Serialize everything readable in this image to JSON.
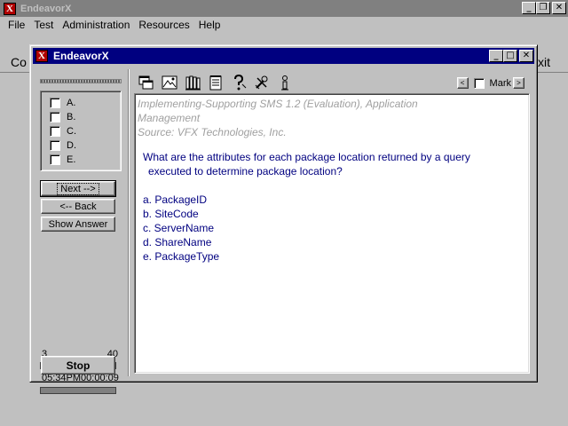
{
  "app": {
    "title": "EndeavorX",
    "icon_glyph": "X",
    "colors": {
      "titlebar_inactive": "#808080",
      "titlebar_active": "#000080",
      "face": "#c0c0c0",
      "question_text": "#000080",
      "source_text": "#a0a0a0",
      "progress": "#00c000"
    }
  },
  "caption_buttons": {
    "minimize": "_",
    "restore": "❐",
    "maximize": "□",
    "close": "✕"
  },
  "menubar": {
    "items": [
      "File",
      "Test",
      "Administration",
      "Resources",
      "Help"
    ]
  },
  "toolbar_fragments": {
    "left": "Co",
    "right": "xit"
  },
  "dialog": {
    "title": "EndeavorX",
    "answers": [
      {
        "label": "A.",
        "checked": false
      },
      {
        "label": "B.",
        "checked": false
      },
      {
        "label": "C.",
        "checked": false
      },
      {
        "label": "D.",
        "checked": false
      },
      {
        "label": "E.",
        "checked": false
      }
    ],
    "buttons": {
      "next": "Next -->",
      "back": "<-- Back",
      "show_answer": "Show Answer",
      "stop": "Stop"
    },
    "counter": {
      "current": "3",
      "total": "40",
      "progress_fraction": 0.075
    },
    "timer": {
      "clock": "05:34PM",
      "elapsed": "00:00:09"
    },
    "toolbar_icons": [
      "windows-icon",
      "picture-icon",
      "library-icon",
      "notepad-icon",
      "hint-icon",
      "tools-icon",
      "info-icon"
    ],
    "nav": {
      "prev": "<",
      "next": ">",
      "mark_label": "Mark",
      "mark_checked": false
    },
    "question": {
      "source_line1": "Implementing-Supporting SMS 1.2 (Evaluation), Application",
      "source_line2": "Management",
      "source_line3": "Source: VFX Technologies, Inc.",
      "stem_line1": "What are the attributes for each package location returned by a query",
      "stem_line2": "executed to determine package location?",
      "options": [
        "a. PackageID",
        "b. SiteCode",
        "c. ServerName",
        "d. ShareName",
        "e. PackageType"
      ]
    }
  }
}
